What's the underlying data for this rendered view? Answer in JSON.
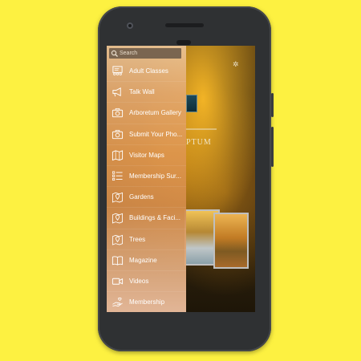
{
  "search": {
    "placeholder": "Search"
  },
  "menu": {
    "items": [
      {
        "label": "Adult Classes",
        "icon": "classroom-icon"
      },
      {
        "label": "Talk Wall",
        "icon": "megaphone-icon"
      },
      {
        "label": "Arboretum Gallery",
        "icon": "camera-icon"
      },
      {
        "label": "Submit Your Pho...",
        "icon": "camera-icon"
      },
      {
        "label": "Visitor Maps",
        "icon": "map-icon"
      },
      {
        "label": "Membership Sur...",
        "icon": "checklist-icon"
      },
      {
        "label": "Gardens",
        "icon": "map-pin-icon"
      },
      {
        "label": "Buildings & Faci...",
        "icon": "map-pin-icon"
      },
      {
        "label": "Trees",
        "icon": "map-pin-icon"
      },
      {
        "label": "Magazine",
        "icon": "book-icon"
      },
      {
        "label": "Videos",
        "icon": "video-camera-icon"
      },
      {
        "label": "Membership",
        "icon": "hand-heart-icon"
      }
    ]
  },
  "background": {
    "title_text": "PTUM"
  },
  "colors": {
    "page_bg": "#fdf141",
    "phone_body": "#2f3133",
    "drawer_tint": "#de9a56"
  }
}
